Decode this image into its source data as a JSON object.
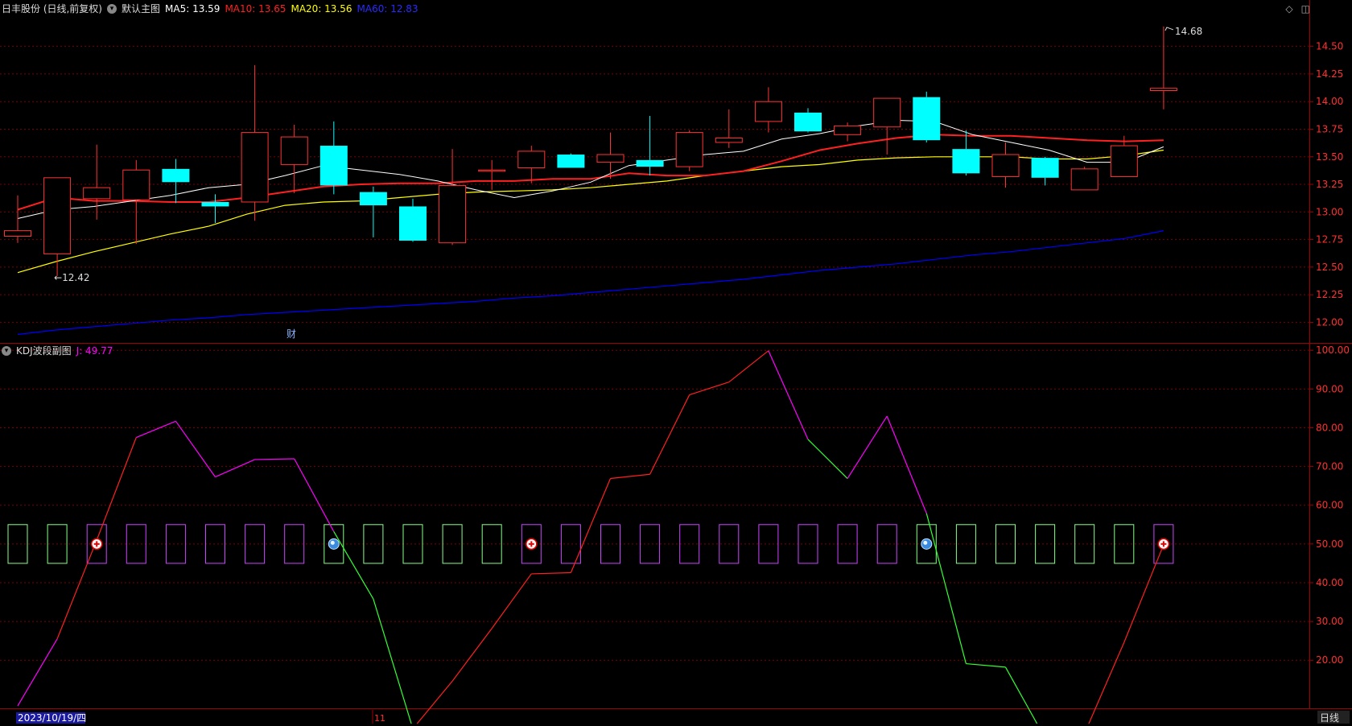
{
  "main_header": {
    "stock": "日丰股份 (日线,前复权)",
    "template": "默认主图",
    "ma5_label": "MA5: 13.59",
    "ma10_label": "MA10: 13.65",
    "ma20_label": "MA20: 13.56",
    "ma60_label": "MA60: 12.83"
  },
  "sub_header": {
    "title": "KDJ波段副图",
    "j_label": "J: 49.77"
  },
  "colors": {
    "up": "#ff3232",
    "down": "#00ffff",
    "ma5": "#ffffff",
    "ma10": "#ff2020",
    "ma20": "#ffff00",
    "ma60": "#0000ff",
    "j_magenta": "#ff00ff",
    "j_green": "#33ff33",
    "grid": "#7a0000"
  },
  "footer": {
    "date": "2023/10/19/四",
    "month": "11",
    "period": "日线"
  },
  "finance_marker": "财",
  "chart_data": [
    {
      "type": "candlestick",
      "name": "main",
      "y_ticks": [
        "14.50",
        "14.25",
        "14.00",
        "13.75",
        "13.50",
        "13.25",
        "13.00",
        "12.75",
        "12.50",
        "12.25",
        "12.00"
      ],
      "ylim": [
        11.85,
        14.76
      ],
      "candles": [
        {
          "o": 12.78,
          "h": 13.15,
          "l": 12.72,
          "c": 12.83
        },
        {
          "o": 12.62,
          "h": 13.31,
          "l": 12.42,
          "c": 13.31
        },
        {
          "o": 13.12,
          "h": 13.61,
          "l": 12.93,
          "c": 13.22
        },
        {
          "o": 13.11,
          "h": 13.47,
          "l": 12.71,
          "c": 13.38
        },
        {
          "o": 13.39,
          "h": 13.48,
          "l": 13.08,
          "c": 13.27
        },
        {
          "o": 13.09,
          "h": 13.16,
          "l": 12.9,
          "c": 13.05
        },
        {
          "o": 13.09,
          "h": 14.33,
          "l": 12.92,
          "c": 13.72
        },
        {
          "o": 13.43,
          "h": 13.79,
          "l": 13.17,
          "c": 13.68
        },
        {
          "o": 13.6,
          "h": 13.82,
          "l": 13.16,
          "c": 13.24
        },
        {
          "o": 13.18,
          "h": 13.23,
          "l": 12.77,
          "c": 13.06
        },
        {
          "o": 13.05,
          "h": 13.12,
          "l": 12.73,
          "c": 12.74
        },
        {
          "o": 12.72,
          "h": 13.57,
          "l": 12.7,
          "c": 13.24
        },
        {
          "o": 13.38,
          "h": 13.47,
          "l": 13.2,
          "c": 13.38
        },
        {
          "o": 13.4,
          "h": 13.6,
          "l": 13.26,
          "c": 13.55
        },
        {
          "o": 13.52,
          "h": 13.53,
          "l": 13.4,
          "c": 13.4
        },
        {
          "o": 13.45,
          "h": 13.72,
          "l": 13.3,
          "c": 13.52
        },
        {
          "o": 13.47,
          "h": 13.87,
          "l": 13.33,
          "c": 13.41
        },
        {
          "o": 13.41,
          "h": 13.74,
          "l": 13.37,
          "c": 13.72
        },
        {
          "o": 13.63,
          "h": 13.93,
          "l": 13.58,
          "c": 13.67
        },
        {
          "o": 13.82,
          "h": 14.13,
          "l": 13.72,
          "c": 14.0
        },
        {
          "o": 13.9,
          "h": 13.94,
          "l": 13.72,
          "c": 13.73
        },
        {
          "o": 13.7,
          "h": 13.81,
          "l": 13.64,
          "c": 13.78
        },
        {
          "o": 13.77,
          "h": 14.03,
          "l": 13.52,
          "c": 14.03
        },
        {
          "o": 14.04,
          "h": 14.09,
          "l": 13.63,
          "c": 13.65
        },
        {
          "o": 13.57,
          "h": 13.74,
          "l": 13.33,
          "c": 13.35
        },
        {
          "o": 13.32,
          "h": 13.63,
          "l": 13.22,
          "c": 13.52
        },
        {
          "o": 13.49,
          "h": 13.5,
          "l": 13.24,
          "c": 13.31
        },
        {
          "o": 13.2,
          "h": 13.41,
          "l": 13.2,
          "c": 13.39
        },
        {
          "o": 13.32,
          "h": 13.69,
          "l": 13.32,
          "c": 13.6
        },
        {
          "o": 14.1,
          "h": 14.68,
          "l": 13.93,
          "c": 14.12
        }
      ],
      "ma5": [
        12.94,
        13.02,
        13.05,
        13.1,
        13.15,
        13.22,
        13.25,
        13.33,
        13.42,
        13.38,
        13.34,
        13.28,
        13.2,
        13.13,
        13.19,
        13.27,
        13.42,
        13.47,
        13.52,
        13.55,
        13.66,
        13.71,
        13.78,
        13.83,
        13.82,
        13.7,
        13.63,
        13.56,
        13.45,
        13.45,
        13.59
      ],
      "ma10": [
        13.02,
        13.13,
        13.1,
        13.1,
        13.09,
        13.09,
        13.13,
        13.18,
        13.23,
        13.25,
        13.26,
        13.26,
        13.28,
        13.28,
        13.3,
        13.3,
        13.35,
        13.33,
        13.33,
        13.37,
        13.46,
        13.56,
        13.62,
        13.67,
        13.7,
        13.69,
        13.69,
        13.67,
        13.65,
        13.64,
        13.65
      ],
      "ma20": [
        12.45,
        12.55,
        12.64,
        12.72,
        12.8,
        12.87,
        12.98,
        13.06,
        13.09,
        13.1,
        13.13,
        13.16,
        13.18,
        13.19,
        13.2,
        13.22,
        13.25,
        13.28,
        13.33,
        13.37,
        13.41,
        13.43,
        13.47,
        13.49,
        13.5,
        13.5,
        13.5,
        13.48,
        13.48,
        13.51,
        13.56
      ],
      "ma60": [
        11.89,
        11.93,
        11.96,
        11.99,
        12.02,
        12.04,
        12.07,
        12.09,
        12.11,
        12.13,
        12.15,
        12.17,
        12.19,
        12.22,
        12.24,
        12.27,
        12.3,
        12.33,
        12.36,
        12.39,
        12.43,
        12.47,
        12.5,
        12.53,
        12.57,
        12.61,
        12.64,
        12.68,
        12.72,
        12.76,
        12.83
      ],
      "annotations": [
        {
          "text": "←12.42",
          "index": 1,
          "value": 12.42
        },
        {
          "text": "14.68",
          "index": 29,
          "value": 14.68
        }
      ]
    },
    {
      "type": "line",
      "name": "KDJ波段副图",
      "y_ticks": [
        "100.00",
        "90.00",
        "80.00",
        "70.00",
        "60.00",
        "50.00",
        "40.00",
        "30.00",
        "20.00"
      ],
      "ylim": [
        8,
        101.5
      ],
      "j": [
        8.2,
        25.5,
        51.0,
        77.5,
        81.7,
        67.3,
        71.8,
        72.0,
        53.2,
        35.8,
        2.3,
        14.6,
        28.2,
        42.3,
        42.6,
        66.9,
        68.0,
        88.5,
        91.8,
        99.9,
        77.0,
        66.9,
        83.0,
        57.9,
        19.1,
        18.2,
        -0.1,
        1.1,
        24.6,
        49.8
      ],
      "j_colors": [
        "m",
        "r",
        "r",
        "m",
        "m",
        "m",
        "m",
        "m",
        "g",
        "g",
        "r",
        "r",
        "r",
        "r",
        "r",
        "r",
        "r",
        "r",
        "r",
        "m",
        "g",
        "m",
        "m",
        "g",
        "g",
        "g",
        "r",
        "r",
        "r",
        "r"
      ],
      "boxes": [
        "g",
        "g",
        "m",
        "m",
        "m",
        "m",
        "m",
        "m",
        "g",
        "g",
        "g",
        "g",
        "g",
        "m",
        "m",
        "m",
        "m",
        "m",
        "m",
        "m",
        "m",
        "m",
        "m",
        "g",
        "g",
        "g",
        "g",
        "g",
        "g",
        "m"
      ],
      "signals": [
        {
          "index": 2,
          "kind": "buy"
        },
        {
          "index": 8,
          "kind": "sell"
        },
        {
          "index": 13,
          "kind": "buy"
        },
        {
          "index": 23,
          "kind": "sell"
        },
        {
          "index": 29,
          "kind": "buy"
        }
      ]
    }
  ]
}
